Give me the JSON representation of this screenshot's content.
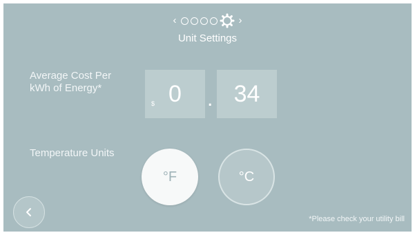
{
  "pager": {
    "prev_arrow": "‹",
    "next_arrow": "›",
    "steps": 5,
    "active_step": 5
  },
  "header": {
    "title": "Unit Settings"
  },
  "energy_cost": {
    "label_line1": "Average Cost Per",
    "label_line2": "kWh of Energy*",
    "currency_symbol": "$",
    "whole": "0",
    "decimal_point": ".",
    "fraction": "34"
  },
  "temperature": {
    "label": "Temperature Units",
    "options": [
      "°F",
      "°C"
    ],
    "selected": "°F"
  },
  "footer": {
    "note": "*Please check your utility bill"
  },
  "icons": {
    "prev": "chevron-left-icon",
    "next": "chevron-right-icon",
    "settings": "gear-icon",
    "back": "back-arrow-icon"
  },
  "colors": {
    "background": "#a8bcc0",
    "field": "#bccdcf",
    "selected_button": "#f7f9f9",
    "text": "#ffffff"
  }
}
